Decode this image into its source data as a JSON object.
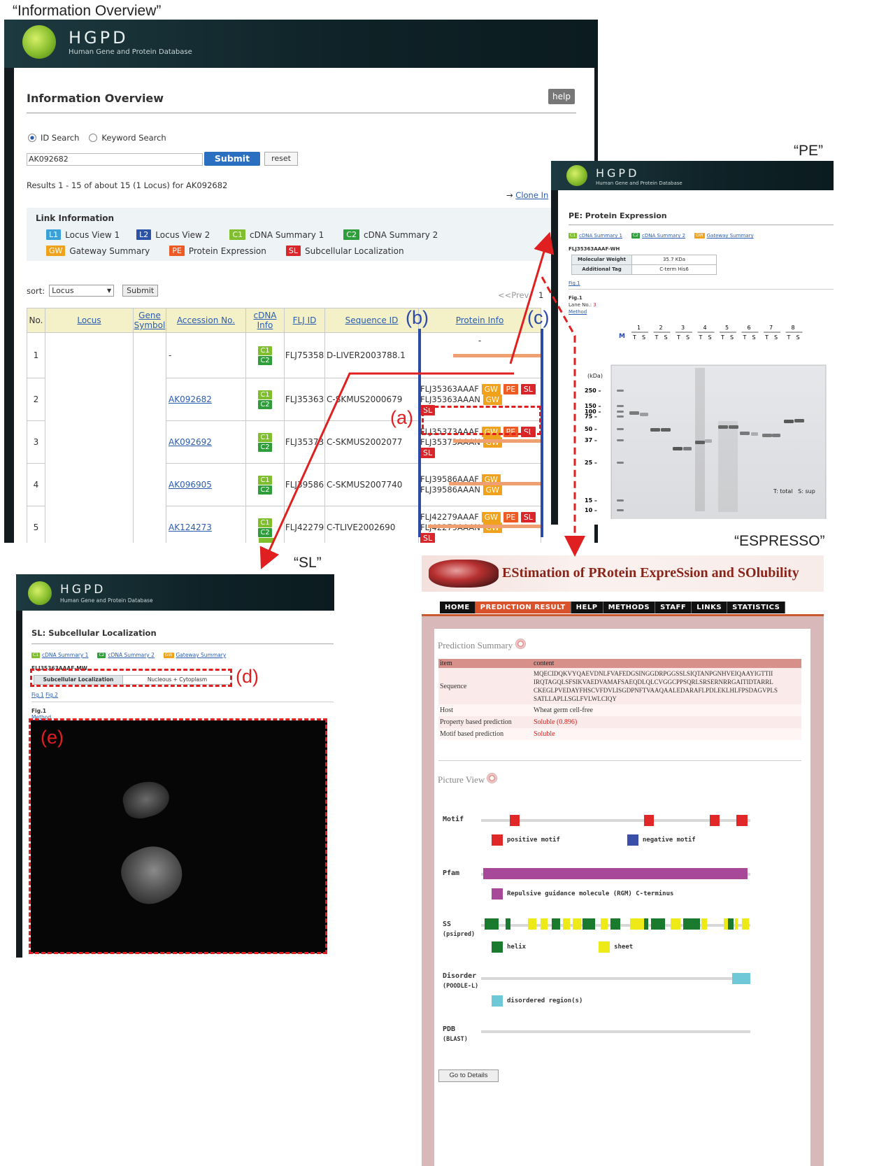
{
  "captions": {
    "info_overview": "“Information Overview”",
    "pe": "“PE”",
    "espresso": "“ESPRESSO”",
    "sl": "“SL”"
  },
  "markers": {
    "a": "(a)",
    "b": "(b)",
    "c": "(c)",
    "d": "(d)",
    "e": "(e)"
  },
  "hgpd": {
    "brand": "HGPD",
    "subtitle": "Human Gene and Protein Database"
  },
  "overview": {
    "title": "Information Overview",
    "help_label": "help",
    "radio_id": "ID Search",
    "radio_keyword": "Keyword Search",
    "search_value": "AK092682",
    "submit_label": "Submit",
    "reset_label": "reset",
    "results_text": "Results 1 - 15 of about 15 (1 Locus) for AK092682",
    "clone_link": "Clone In",
    "link_info_title": "Link Information",
    "legend": [
      {
        "tag": "L1",
        "label": "Locus View 1"
      },
      {
        "tag": "L2",
        "label": "Locus View 2"
      },
      {
        "tag": "C1",
        "label": "cDNA Summary 1"
      },
      {
        "tag": "C2",
        "label": "cDNA Summary 2"
      },
      {
        "tag": "GW",
        "label": "Gateway Summary"
      },
      {
        "tag": "PE",
        "label": "Protein Expression"
      },
      {
        "tag": "SL",
        "label": "Subcellular Localization"
      }
    ],
    "sort_label": "sort:",
    "sort_value": "Locus",
    "sort_submit": "Submit",
    "prev_label": "<<Prev",
    "page_num": "1",
    "columns": [
      "No.",
      "Locus",
      "Gene Symbol",
      "Accession No.",
      "cDNA Info",
      "FLJ ID",
      "Sequence ID",
      "Protein Info"
    ],
    "rows": [
      {
        "no": "1",
        "acc": "-",
        "flj": "FLJ75358",
        "seq": "D-LIVER2003788.1",
        "protein": [
          "-"
        ]
      },
      {
        "no": "2",
        "acc": "AK092682",
        "flj": "FLJ35363",
        "seq": "C-SKMUS2000679",
        "protein": [
          "FLJ35363AAAF",
          "FLJ35363AAAN"
        ]
      },
      {
        "no": "3",
        "acc": "AK092692",
        "flj": "FLJ35373",
        "seq": "C-SKMUS2002077",
        "protein": [
          "FLJ35373AAAF",
          "FLJ35373AAAN"
        ]
      },
      {
        "no": "4",
        "acc": "AK096905",
        "flj": "FLJ39586",
        "seq": "C-SKMUS2007740",
        "protein": [
          "FLJ39586AAAF",
          "FLJ39586AAAN"
        ]
      },
      {
        "no": "5",
        "acc": "AK124273",
        "flj": "FLJ42279",
        "seq": "C-TLIVE2002690",
        "protein": [
          "FLJ42279AAAF",
          "FLJ42279AAAN"
        ]
      }
    ],
    "tags": {
      "c1": "C1",
      "c2": "C2",
      "gw": "GW",
      "pe": "PE",
      "sl": "SL"
    }
  },
  "pe": {
    "title": "PE: Protein Expression",
    "links": [
      "cDNA Summary 1",
      "cDNA Summary 2",
      "Gateway Summary"
    ],
    "clone_id": "FLJ35363AAAF-WH",
    "mw_label": "Molecular Weight",
    "mw_value": "35.7 KDa",
    "tag_label": "Additional Tag",
    "tag_value": "C-term His6",
    "fig_link": "Fig.1",
    "fig_title": "Fig.1",
    "lane_label": "Lane No.:",
    "lane_value": "3",
    "method_link": "Method",
    "gel": {
      "marker_label": "M",
      "lanes": [
        "1",
        "2",
        "3",
        "4",
        "5",
        "6",
        "7",
        "8"
      ],
      "ts": [
        "T",
        "S"
      ],
      "kda_label": "(kDa)",
      "kda_ticks": [
        "250",
        "150",
        "100",
        "75",
        "50",
        "37",
        "25",
        "15",
        "10"
      ],
      "legend": "T: total   S: sup"
    }
  },
  "sl": {
    "title": "SL: Subcellular Localization",
    "links": [
      "cDNA Summary 1",
      "cDNA Summary 2",
      "Gateway Summary"
    ],
    "clone_id": "FLJ35363AAAF-MW",
    "loc_label": "Subcellular Localization",
    "loc_value": "Nucleous + Cytoplasm",
    "fig_links": [
      "Fig.1",
      "Fig.2"
    ],
    "fig_title": "Fig.1",
    "method_link": "Method"
  },
  "espresso": {
    "title": "EStimation of PRotein ExpreSsion and SOlubility",
    "nav": [
      "HOME",
      "PREDICTION RESULT",
      "HELP",
      "METHODS",
      "STAFF",
      "LINKS",
      "STATISTICS"
    ],
    "summary_title": "Prediction Summary",
    "col_item": "item",
    "col_content": "content",
    "sequence_label": "Sequence",
    "sequence_lines": [
      "MQECIDQKVYQAEVDNLFVAFEDGSINGGDRPGGSSLSIQTANPGNHVEIQAAYIGTTII",
      "IRQTAGQLSFSIKVAEDVAMAFSAEQDLQLCVGGCPPSQRLSRSERNRRGAITIDTARRL",
      "CKEGLPVEDAYFHSCVFDVLISGDPNFTVAAQAALEDARAFLPDLEKLHLFPSDAGVPLS",
      "SATLLAPLLSGLFVLWLCIQY"
    ],
    "host_label": "Host",
    "host_value": "Wheat germ cell-free",
    "prop_label": "Property based prediction",
    "prop_value": "Soluble (0.896)",
    "motif_pred_label": "Motif based prediction",
    "motif_pred_value": "Soluble",
    "picture_title": "Picture View",
    "tracks": {
      "motif": "Motif",
      "pfam": "Pfam",
      "ss": "SS",
      "ss_sub": "(psipred)",
      "disorder": "Disorder",
      "disorder_sub": "(POODLE-L)",
      "pdb": "PDB",
      "pdb_sub": "(BLAST)"
    },
    "legend": {
      "positive": "positive motif",
      "negative": "negative motif",
      "pfam": "Repulsive guidance molecule (RGM) C-terminus",
      "helix": "helix",
      "sheet": "sheet",
      "disordered": "disordered region(s)"
    },
    "details_button": "Go to Details",
    "colors": {
      "positive": "#e02828",
      "negative": "#3a4fa8",
      "pfam": "#a84898",
      "helix": "#1a7a2e",
      "sheet": "#eeea18",
      "disorder": "#6ec8d8"
    }
  }
}
